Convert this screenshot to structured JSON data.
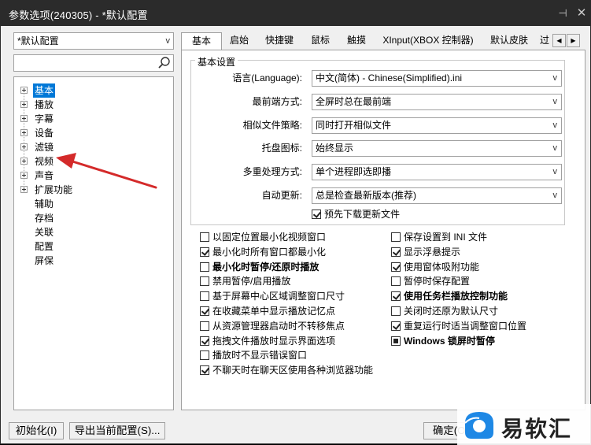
{
  "window": {
    "title": "参数选项(240305) - *默认配置",
    "pin_glyph": "⊣",
    "close_glyph": "✕"
  },
  "left": {
    "profile": "*默认配置",
    "tree": [
      {
        "label": "基本",
        "expandable": true,
        "selected": true
      },
      {
        "label": "播放",
        "expandable": true
      },
      {
        "label": "字幕",
        "expandable": true
      },
      {
        "label": "设备",
        "expandable": true
      },
      {
        "label": "滤镜",
        "expandable": true
      },
      {
        "label": "视频",
        "expandable": true
      },
      {
        "label": "声音",
        "expandable": true
      },
      {
        "label": "扩展功能",
        "expandable": true
      },
      {
        "label": "辅助",
        "expandable": false
      },
      {
        "label": "存档",
        "expandable": false
      },
      {
        "label": "关联",
        "expandable": false
      },
      {
        "label": "配置",
        "expandable": false
      },
      {
        "label": "屏保",
        "expandable": false
      }
    ]
  },
  "tabs": [
    "基本",
    "启始",
    "快捷键",
    "鼠标",
    "触摸",
    "XInput(XBOX 控制器)",
    "默认皮肤",
    "过"
  ],
  "tab_scroll": {
    "left": "◀",
    "right": "▶"
  },
  "basic": {
    "group_title": "基本设置",
    "fields": [
      {
        "label": "语言(Language):",
        "value": "中文(简体) - Chinese(Simplified).ini"
      },
      {
        "label": "最前端方式:",
        "value": "全屏时总在最前端"
      },
      {
        "label": "相似文件策略:",
        "value": "同时打开相似文件"
      },
      {
        "label": "托盘图标:",
        "value": "始终显示"
      },
      {
        "label": "多重处理方式:",
        "value": "单个进程即选即播"
      },
      {
        "label": "自动更新:",
        "value": "总是检查最新版本(推荐)"
      }
    ],
    "predownload": {
      "label": "预先下载更新文件",
      "checked": true
    }
  },
  "options_left": [
    {
      "label": "以固定位置最小化视频窗口",
      "state": "unchecked"
    },
    {
      "label": "最小化时所有窗口都最小化",
      "state": "checked"
    },
    {
      "label": "最小化时暂停/还原时播放",
      "state": "unchecked",
      "bold": true
    },
    {
      "label": "禁用暂停/启用播放",
      "state": "unchecked"
    },
    {
      "label": "基于屏幕中心区域调整窗口尺寸",
      "state": "unchecked"
    },
    {
      "label": "在收藏菜单中显示播放记忆点",
      "state": "checked"
    },
    {
      "label": "从资源管理器启动时不转移焦点",
      "state": "unchecked"
    },
    {
      "label": "拖拽文件播放时显示界面选项",
      "state": "checked"
    },
    {
      "label": "播放时不显示错误窗口",
      "state": "unchecked"
    },
    {
      "label": "不聊天时在聊天区使用各种浏览器功能",
      "state": "checked"
    }
  ],
  "options_right": [
    {
      "label": "保存设置到 INI 文件",
      "state": "unchecked"
    },
    {
      "label": "显示浮悬提示",
      "state": "checked"
    },
    {
      "label": "使用窗体吸附功能",
      "state": "checked"
    },
    {
      "label": "暂停时保存配置",
      "state": "unchecked"
    },
    {
      "label": "使用任务栏播放控制功能",
      "state": "checked",
      "bold": true
    },
    {
      "label": "关闭时还原为默认尺寸",
      "state": "unchecked"
    },
    {
      "label": "重复运行时适当调整窗口位置",
      "state": "checked"
    },
    {
      "label": "Windows 锁屏时暂停",
      "state": "partial",
      "bold": true
    }
  ],
  "footer": {
    "init": "初始化(I)",
    "export": "导出当前配置(S)...",
    "ok": "确定(O)"
  },
  "watermark": {
    "text": "易软汇"
  },
  "colors": {
    "titlebar": "#2b2b2b",
    "selection": "#0078d7",
    "annotation_arrow": "#d42a2a"
  },
  "icons": [
    "search-icon",
    "chevron-down-icon",
    "pin-icon",
    "close-icon",
    "plus-expander-icon",
    "annotation-arrow-icon",
    "watermark-logo-icon"
  ]
}
